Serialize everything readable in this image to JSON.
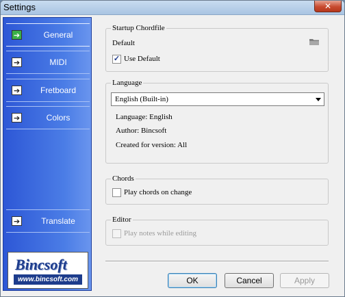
{
  "window": {
    "title": "Settings",
    "close_glyph": "✕"
  },
  "sidebar": {
    "items": [
      {
        "label": "General",
        "icon": "arrow-right-icon",
        "selected": true
      },
      {
        "label": "MIDI",
        "icon": "arrow-right-icon"
      },
      {
        "label": "Fretboard",
        "icon": "arrow-right-icon"
      },
      {
        "label": "Colors",
        "icon": "arrow-right-icon"
      },
      {
        "label": "Translate",
        "icon": "arrow-right-icon"
      }
    ],
    "arrow_glyph": "➔",
    "logo": {
      "name": "Bincsoft",
      "url": "www.bincsoft.com"
    }
  },
  "startup_chordfile": {
    "title": "Startup Chordfile",
    "value": "Default",
    "use_default_label": "Use Default",
    "use_default_checked": true,
    "check_glyph": "✓"
  },
  "language": {
    "title": "Language",
    "selected": "English (Built-in)",
    "info_language": "Language: English",
    "info_author": "Author: Bincsoft",
    "info_version": "Created for version: All"
  },
  "chords": {
    "title": "Chords",
    "play_on_change_label": "Play chords on change",
    "play_on_change_checked": false
  },
  "editor": {
    "title": "Editor",
    "play_while_editing_label": "Play notes while editing",
    "play_while_editing_checked": false,
    "enabled": false
  },
  "buttons": {
    "ok": "OK",
    "cancel": "Cancel",
    "apply": "Apply"
  },
  "colors": {
    "sidebar_blue": "#2d57d6",
    "accent_green": "#3ab048"
  }
}
